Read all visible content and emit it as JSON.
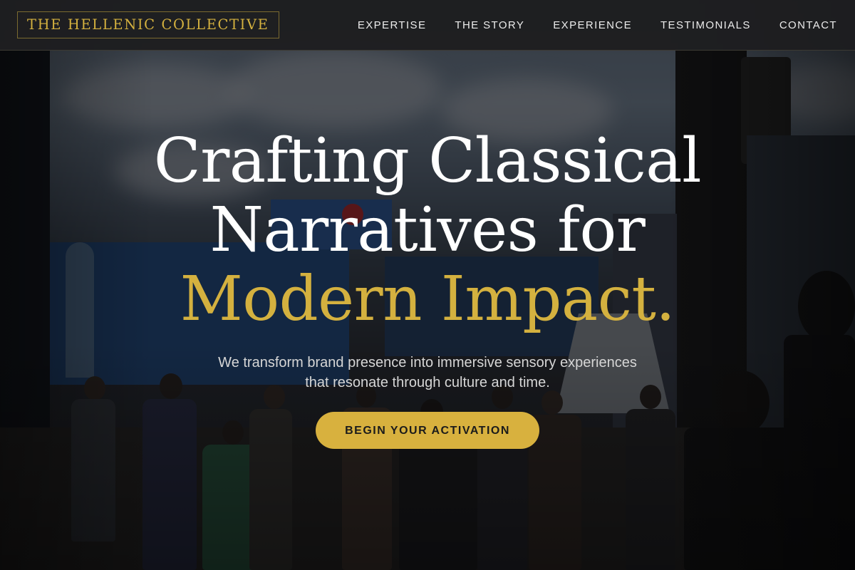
{
  "brand": {
    "logo_text": "THE HELLENIC COLLECTIVE"
  },
  "nav": {
    "items": [
      {
        "label": "EXPERTISE"
      },
      {
        "label": "THE STORY"
      },
      {
        "label": "EXPERIENCE"
      },
      {
        "label": "TESTIMONIALS"
      },
      {
        "label": "CONTACT"
      }
    ]
  },
  "hero": {
    "headline_line1": "Crafting Classical",
    "headline_line2": "Narratives for",
    "headline_accent": "Modern Impact.",
    "subtext_line1": "We transform brand presence into immersive sensory experiences",
    "subtext_line2": "that resonate through culture and time.",
    "cta_label": "BEGIN YOUR ACTIVATION"
  },
  "colors": {
    "accent_gold": "#d4b13f",
    "navbar_bg": "#1e1e20",
    "text_white": "#ffffff"
  }
}
